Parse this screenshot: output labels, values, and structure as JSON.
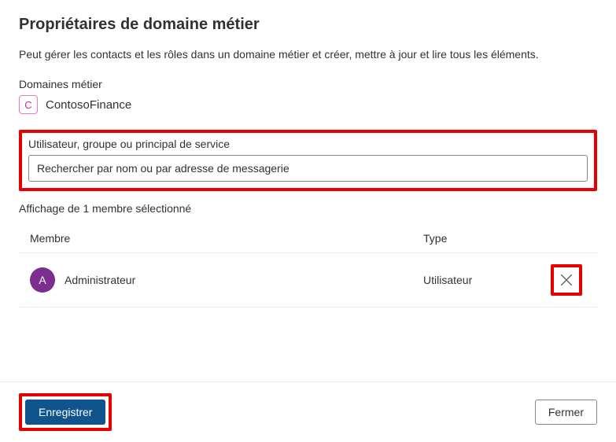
{
  "title": "Propriétaires de domaine métier",
  "description": "Peut gérer les contacts et les rôles dans un domaine métier et créer, mettre à jour et lire tous les éléments.",
  "domains_label": "Domaines métier",
  "domain": {
    "initial": "C",
    "name": "ContosoFinance"
  },
  "search": {
    "label": "Utilisateur, groupe ou principal de service",
    "placeholder": "Rechercher par nom ou par adresse de messagerie"
  },
  "count_label": "Affichage de 1 membre sélectionné",
  "table": {
    "headers": {
      "member": "Membre",
      "type": "Type"
    },
    "rows": [
      {
        "avatar_initial": "A",
        "name": "Administrateur",
        "type": "Utilisateur"
      }
    ]
  },
  "buttons": {
    "save": "Enregistrer",
    "close": "Fermer"
  }
}
